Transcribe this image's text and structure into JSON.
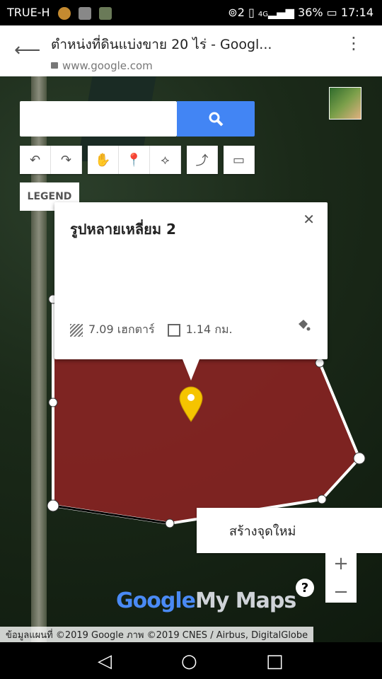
{
  "status": {
    "carrier": "TRUE-H",
    "battery": "36%",
    "time": "17:14",
    "network": "4G",
    "sim": "2"
  },
  "browser": {
    "title": "ตำหน่งที่ดินแบ่งขาย 20 ไร่ - Googl...",
    "url": "www.google.com"
  },
  "map": {
    "search": {
      "placeholder": ""
    },
    "legend_label": "LEGEND",
    "popup": {
      "title": "รูปหลายเหลี่ยม 2",
      "area": "7.09 เฮกตาร์",
      "perimeter": "1.14 กม."
    },
    "context_menu": {
      "item": "สร้างจุดใหม่"
    },
    "zoom": {
      "in": "+",
      "out": "−"
    },
    "help": "?",
    "brand": {
      "google": "Google",
      "mymaps": "My Maps"
    },
    "attribution": "ข้อมูลแผนที่ ©2019 Google ภาพ ©2019 CNES / Airbus, DigitalGlobe",
    "polygon_fill": "#8c2323",
    "marker_color": "#f5c400",
    "accent": "#4285f4"
  }
}
